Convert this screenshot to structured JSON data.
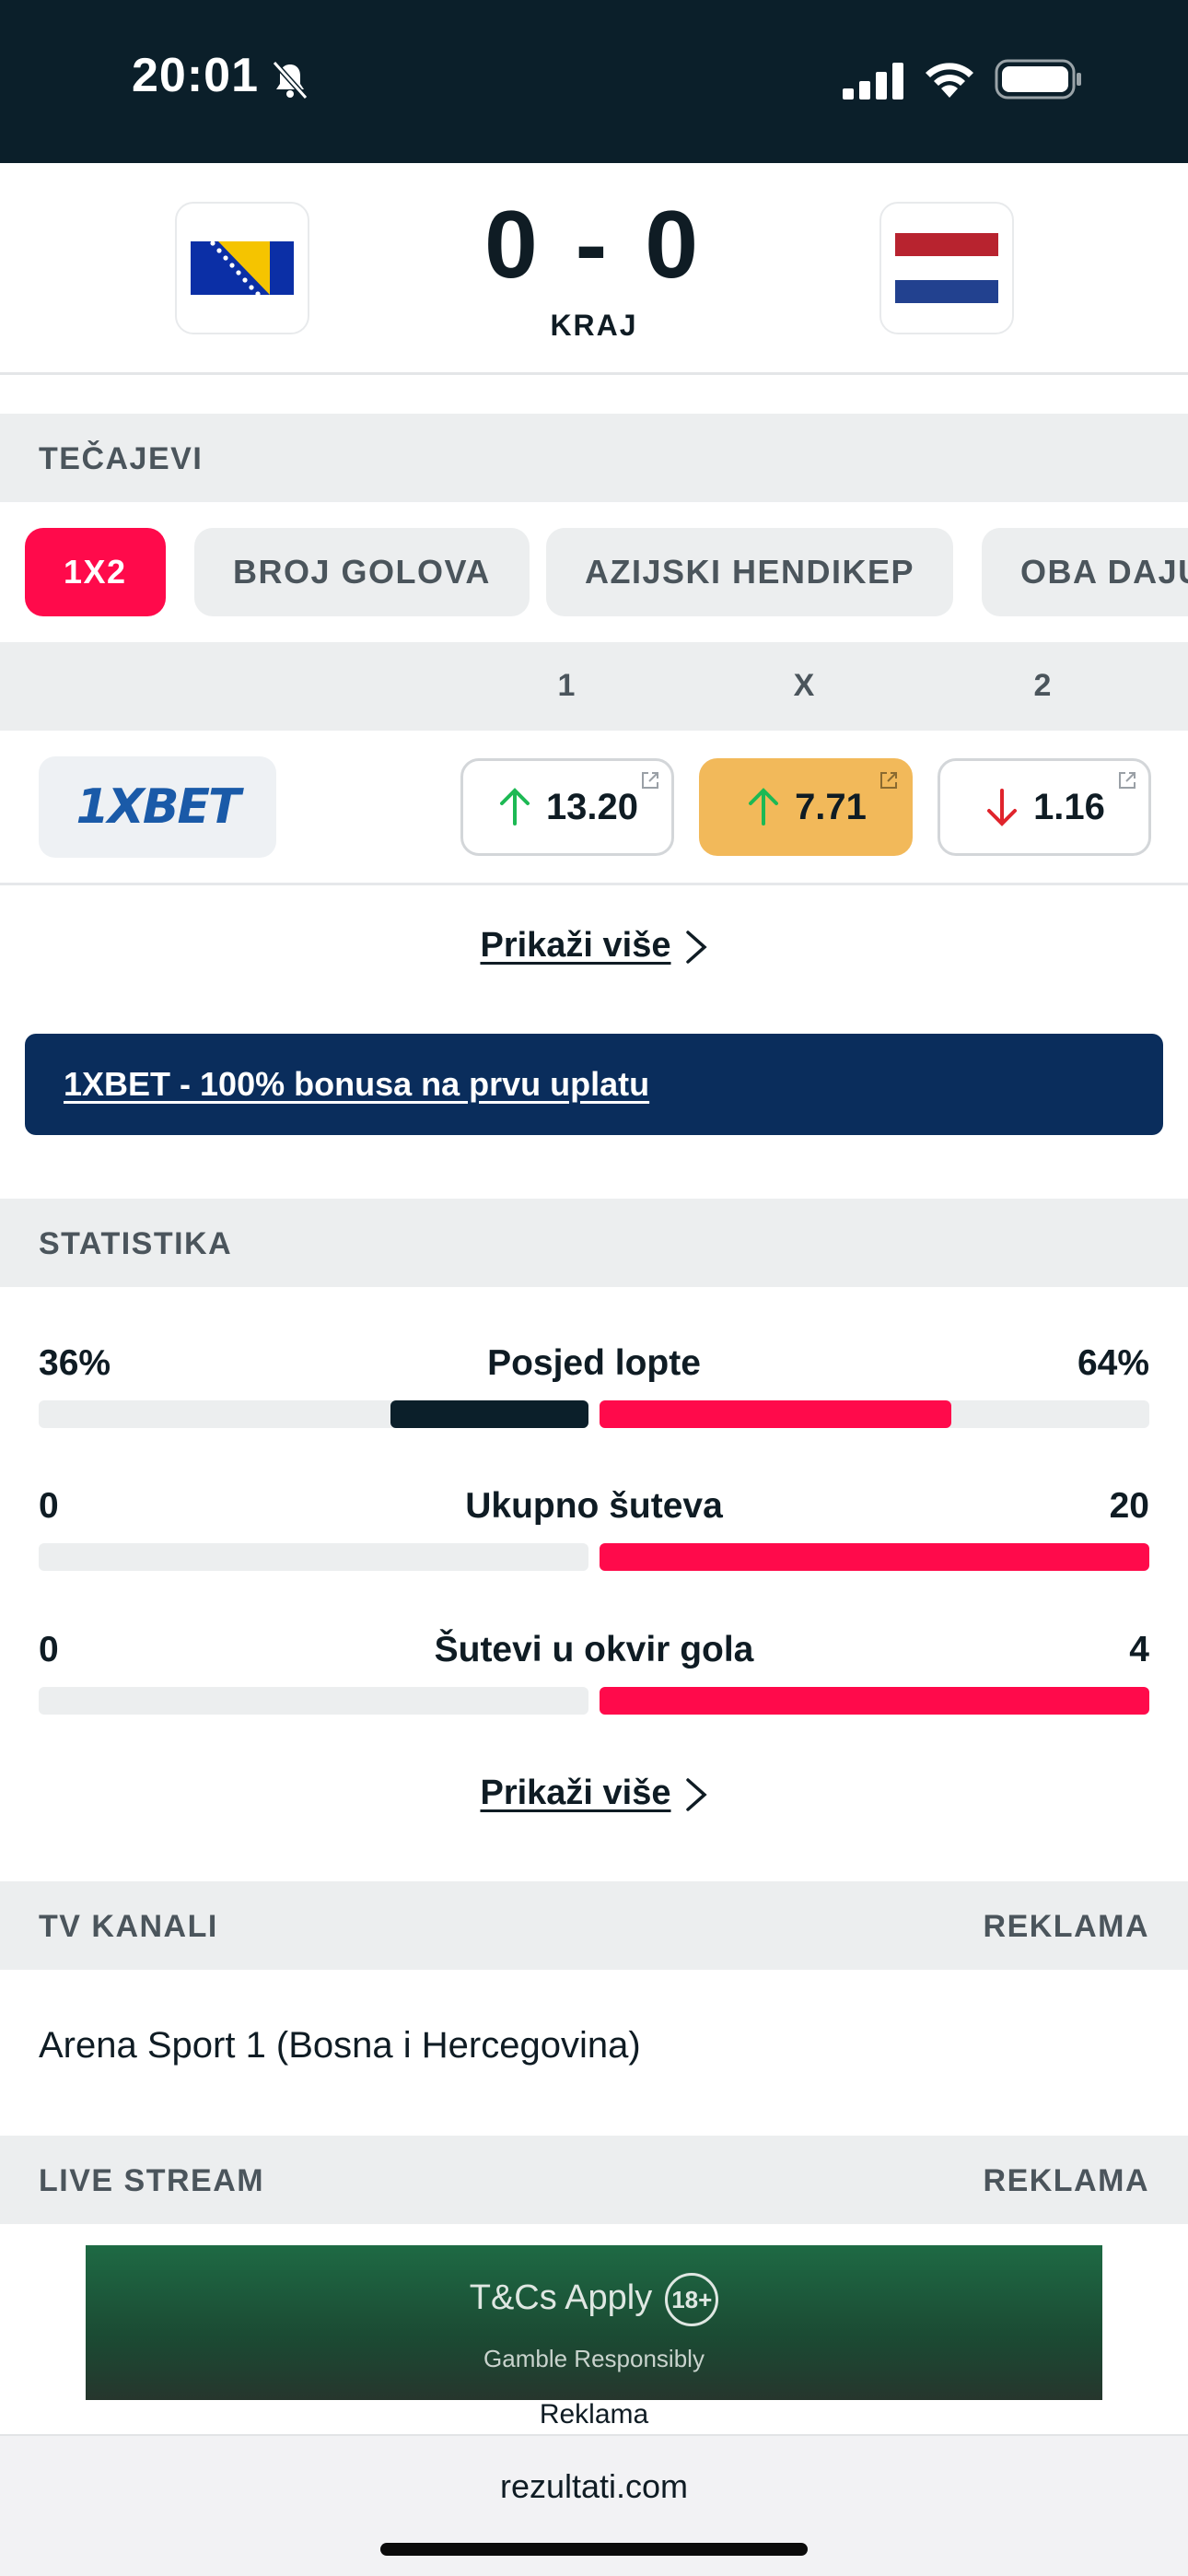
{
  "status_bar": {
    "time": "20:01"
  },
  "match": {
    "score": "0 - 0",
    "status": "KRAJ",
    "home_flag": "bosnia-flag",
    "away_flag": "netherlands-flag"
  },
  "odds_section": {
    "title": "TEČAJEVI",
    "tabs": [
      {
        "label": "1X2",
        "active": true
      },
      {
        "label": "BROJ GOLOVA",
        "active": false
      },
      {
        "label": "AZIJSKI HENDIKEP",
        "active": false
      },
      {
        "label": "OBA DAJU",
        "active": false
      }
    ],
    "columns": [
      "1",
      "X",
      "2"
    ],
    "bookmaker": "1XBET",
    "odds": [
      {
        "value": "13.20",
        "trend": "up"
      },
      {
        "value": "7.71",
        "trend": "up"
      },
      {
        "value": "1.16",
        "trend": "down"
      }
    ],
    "show_more": "Prikaži više"
  },
  "promo": {
    "text": "1XBET - 100% bonusa na prvu uplatu"
  },
  "stats_section": {
    "title": "STATISTIKA",
    "rows": [
      {
        "label": "Posjed lopte",
        "home": "36%",
        "away": "64%",
        "home_fraction": 0.36,
        "away_fraction": 0.64
      },
      {
        "label": "Ukupno šuteva",
        "home": "0",
        "away": "20",
        "home_fraction": 0,
        "away_fraction": 1
      },
      {
        "label": "Šutevi u okvir gola",
        "home": "0",
        "away": "4",
        "home_fraction": 0,
        "away_fraction": 1
      }
    ],
    "show_more": "Prikaži više"
  },
  "tv_section": {
    "title": "TV KANALI",
    "tag": "REKLAMA",
    "channel": "Arena Sport 1 (Bosna i Hercegovina)"
  },
  "stream_section": {
    "title": "LIVE STREAM",
    "tag": "REKLAMA"
  },
  "ad": {
    "main": "T&Cs Apply",
    "badge": "18+",
    "sub": "Gamble Responsibly",
    "caption": "Reklama"
  },
  "footer": {
    "domain": "rezultati.com"
  },
  "colors": {
    "accent": "#ff0a4b",
    "dark": "#0b1f2a",
    "highlight": "#f2b95a",
    "promo": "#0a2d5c",
    "up": "#1db954",
    "down": "#e0242c"
  }
}
